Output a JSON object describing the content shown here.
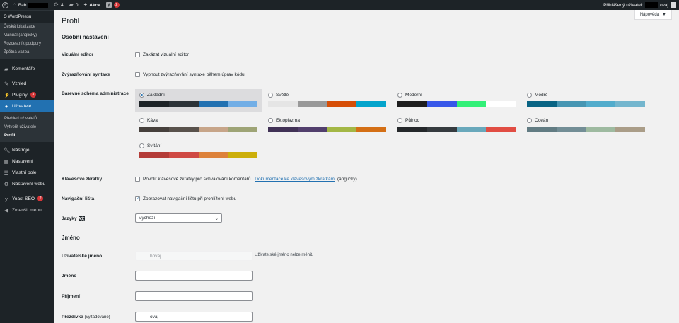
{
  "admin_bar": {
    "site_name": "Bab",
    "updates_count": "4",
    "comments_count": "0",
    "new_label": "Akce",
    "yoast_badge": "2",
    "greeting": "Přihlášený uživatel:",
    "username_suffix": "ovaj"
  },
  "sidebar": {
    "wp_submenu": [
      "O WordPressu",
      "Česká lokalizace",
      "Manuál (anglicky)",
      "Rozcestník podpory",
      "Zpětná vazba"
    ],
    "items": {
      "comments": "Komentáře",
      "appearance": "Vzhled",
      "plugins": "Pluginy",
      "plugins_badge": "3",
      "users": "Uživatelé",
      "tools": "Nástroje",
      "settings": "Nastavení",
      "custom_fields": "Vlastní pole",
      "site_settings": "Nastavení webu",
      "yoast": "Yoast SEO",
      "yoast_badge": "2",
      "collapse": "Zmenšit menu"
    },
    "users_submenu": [
      "Přehled uživatelů",
      "Vytvořit uživatele",
      "Profil"
    ]
  },
  "help_button": "Nápověda",
  "page": {
    "title": "Profil",
    "personal_heading": "Osobní nastavení",
    "visual_editor": {
      "label": "Vizuální editor",
      "checkbox": "Zakázat vizuální editor",
      "checked": false
    },
    "syntax": {
      "label": "Zvýrazňování syntaxe",
      "checkbox": "Vypnout zvýrazňování syntaxe během úprav kódu",
      "checked": false
    },
    "color_scheme_label": "Barevné schéma administrace",
    "shortcuts": {
      "label": "Klávesové zkratky",
      "checkbox": "Povolit klávesové zkratky pro schvalování komentářů.",
      "link": "Dokumentace ke klávesovým zkratkám",
      "suffix": "(anglicky)",
      "checked": false
    },
    "toolbar": {
      "label": "Navigační lišta",
      "checkbox": "Zobrazovat navigační lištu při prohlížení webu",
      "checked": true
    },
    "language": {
      "label": "Jazyky",
      "value": "Výchozí"
    },
    "name_heading": "Jméno",
    "username": {
      "label": "Uživatelské jméno",
      "value_suffix": "hovaj",
      "description": "Uživatelské jméno nelze měnit."
    },
    "first_name": {
      "label": "Jméno",
      "value": ""
    },
    "last_name": {
      "label": "Příjmení",
      "value": ""
    },
    "nickname": {
      "label": "Přezdívka",
      "required": "(vyžadováno)",
      "value_suffix": "ovaj"
    }
  },
  "color_schemes": [
    {
      "name": "Základní",
      "selected": true,
      "colors": [
        "#1d2327",
        "#2c3338",
        "#2271b1",
        "#72aee6"
      ]
    },
    {
      "name": "Světlé",
      "selected": false,
      "colors": [
        "#e5e5e5",
        "#999999",
        "#d64e07",
        "#04a4cc"
      ]
    },
    {
      "name": "Moderní",
      "selected": false,
      "colors": [
        "#1e1e1e",
        "#3858e9",
        "#33f078",
        "#ffffff"
      ]
    },
    {
      "name": "Modré",
      "selected": false,
      "colors": [
        "#096484",
        "#4796b3",
        "#52accc",
        "#74b6ce"
      ]
    },
    {
      "name": "Káva",
      "selected": false,
      "colors": [
        "#46403c",
        "#59524c",
        "#c7a589",
        "#9ea476"
      ]
    },
    {
      "name": "Ektoplazma",
      "selected": false,
      "colors": [
        "#413256",
        "#523f6d",
        "#a3b745",
        "#d46f15"
      ]
    },
    {
      "name": "Půlnoc",
      "selected": false,
      "colors": [
        "#25282b",
        "#363b3f",
        "#69a8bb",
        "#e14d43"
      ]
    },
    {
      "name": "Oceán",
      "selected": false,
      "colors": [
        "#627c83",
        "#738e96",
        "#9ebaa0",
        "#aa9d88"
      ]
    },
    {
      "name": "Svítání",
      "selected": false,
      "colors": [
        "#b43c38",
        "#cf4944",
        "#dd823b",
        "#ccaf0b"
      ]
    }
  ]
}
